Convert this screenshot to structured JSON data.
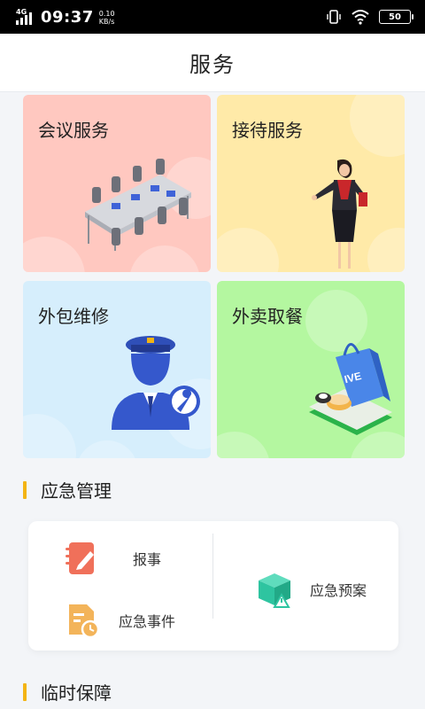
{
  "status_bar": {
    "network": "4G",
    "time": "09:37",
    "speed_value": "0.10",
    "speed_unit": "KB/s",
    "battery": "50",
    "icons": [
      "signal-icon",
      "vibrate-icon",
      "wifi-icon",
      "battery-icon"
    ]
  },
  "header": {
    "title": "服务"
  },
  "services": [
    {
      "label": "会议服务",
      "icon": "meeting-room-illustration",
      "color": "#ffc8c0"
    },
    {
      "label": "接待服务",
      "icon": "reception-illustration",
      "color": "#ffeaa8"
    },
    {
      "label": "外包维修",
      "icon": "repair-worker-illustration",
      "color": "#d6eefc"
    },
    {
      "label": "外卖取餐",
      "icon": "takeout-bag-illustration",
      "color": "#b4f7a0"
    }
  ],
  "sections": {
    "emergency": {
      "title": "应急管理",
      "items": [
        {
          "label": "报事",
          "icon": "report-notebook-icon",
          "color": "#f0705a"
        },
        {
          "label": "应急事件",
          "icon": "event-document-icon",
          "color": "#f3b45a"
        },
        {
          "label": "应急预案",
          "icon": "plan-box-icon",
          "color": "#2ec4a0"
        }
      ]
    },
    "support": {
      "title": "临时保障"
    }
  },
  "accent_color": "#f3b414"
}
